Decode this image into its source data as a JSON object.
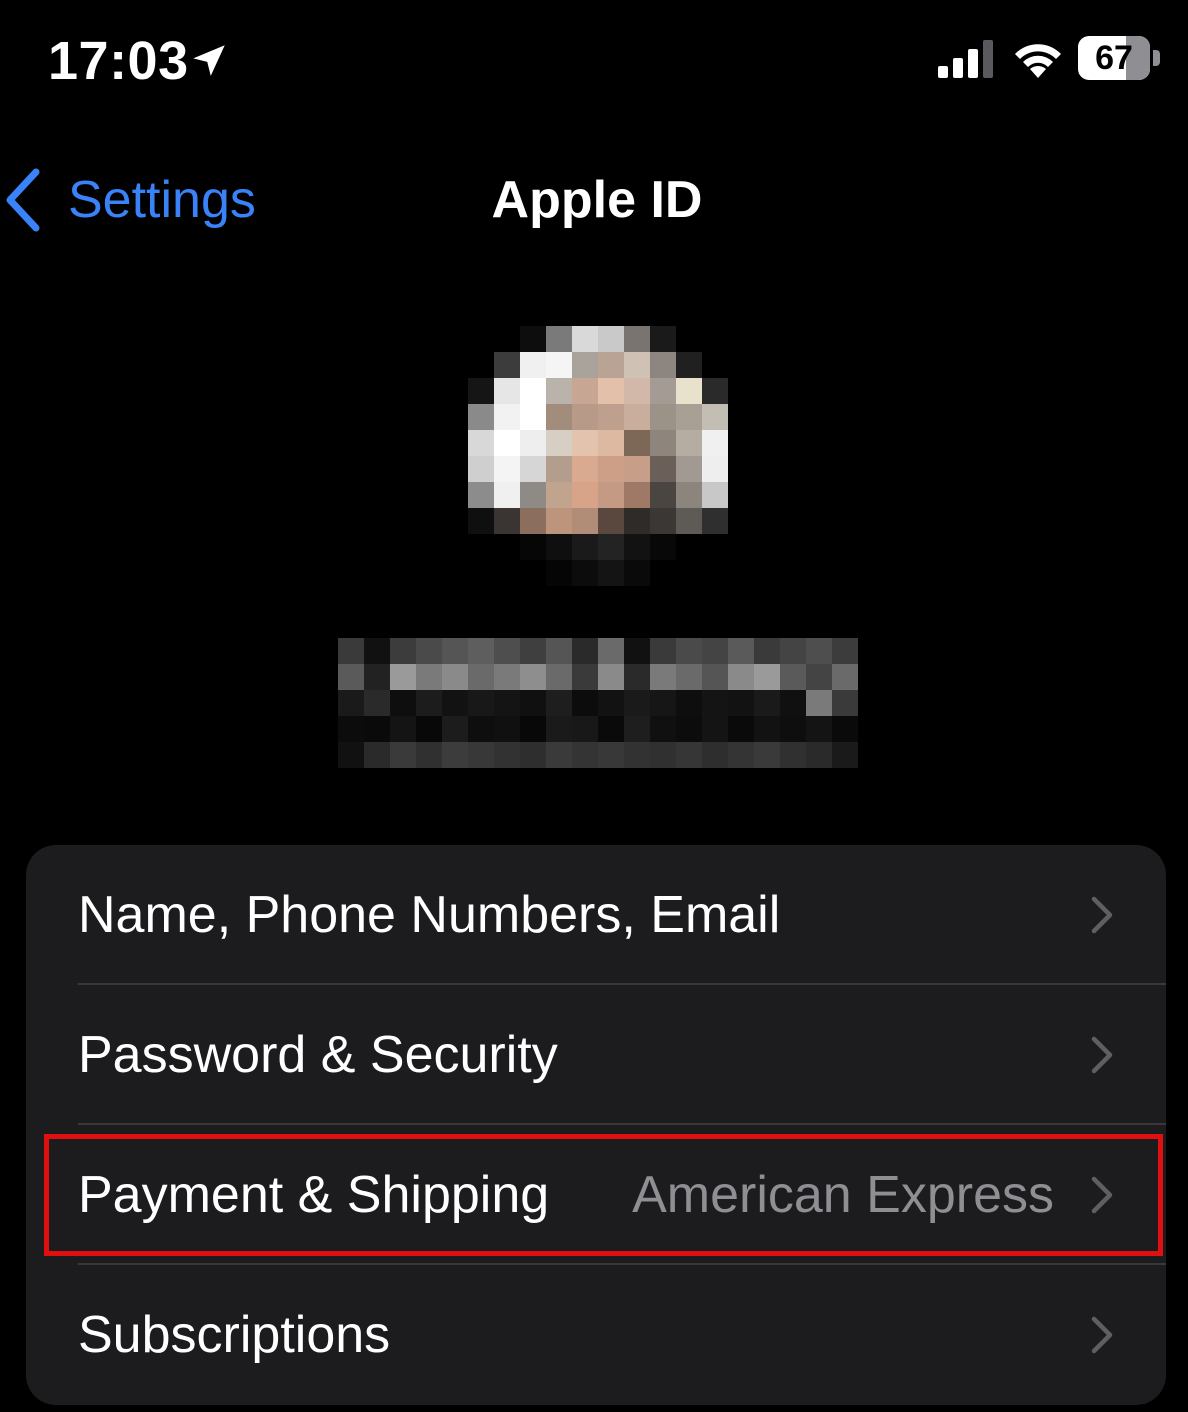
{
  "status_bar": {
    "time": "17:03",
    "battery_level": "67",
    "icons": [
      "location-arrow-icon",
      "cellular-signal-icon",
      "wifi-icon",
      "battery-icon"
    ]
  },
  "nav": {
    "back_label": "Settings",
    "title": "Apple ID"
  },
  "profile": {
    "avatar": "pixelated-profile-photo",
    "name_and_email": "pixelated (redacted)"
  },
  "menu": {
    "items": [
      {
        "label": "Name, Phone Numbers, Email",
        "value": ""
      },
      {
        "label": "Password & Security",
        "value": ""
      },
      {
        "label": "Payment & Shipping",
        "value": "American Express"
      },
      {
        "label": "Subscriptions",
        "value": ""
      }
    ]
  },
  "highlight": {
    "target": "Payment & Shipping",
    "color": "#e01010"
  },
  "colors": {
    "background": "#000000",
    "group_background": "#1c1c1e",
    "accent": "#3a82f7",
    "secondary_text": "#8e8e93"
  }
}
